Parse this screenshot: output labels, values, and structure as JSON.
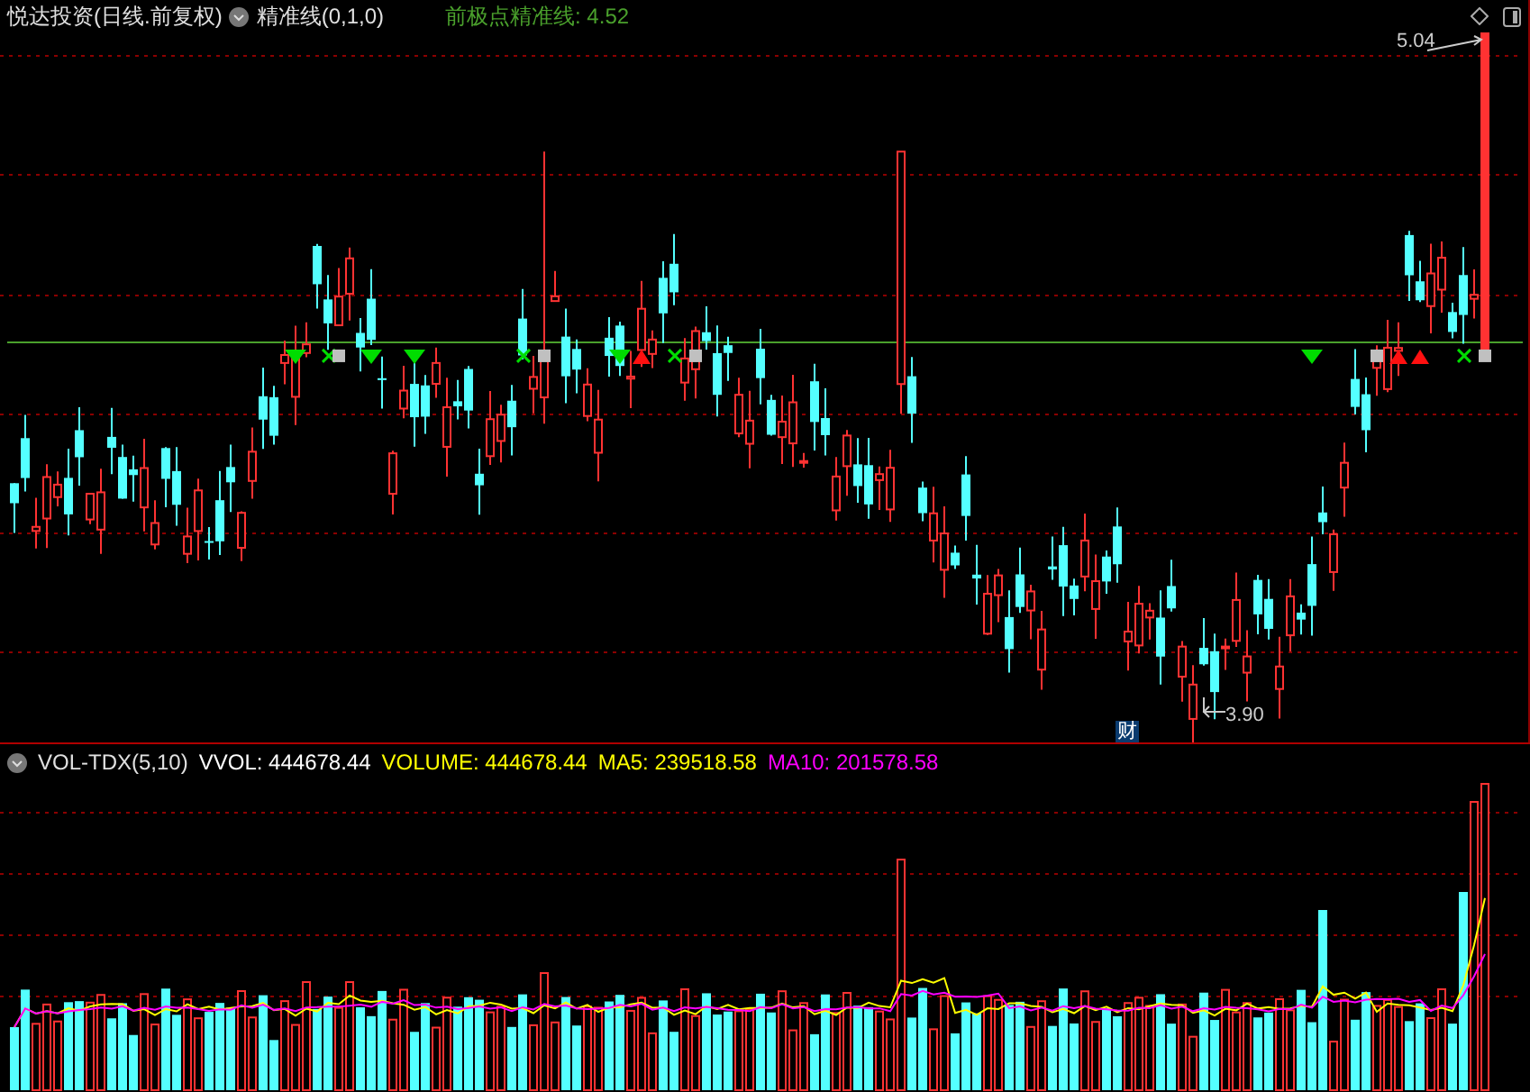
{
  "header": {
    "title": "悦达投资(日线.前复权)",
    "indicator": "精准线(0,1,0)",
    "line_label": "前极点精准线: 4.52"
  },
  "price_labels": {
    "high": "5.04",
    "low": "3.90"
  },
  "finance_badge": "财",
  "volume_header": {
    "name": "VOL-TDX(5,10)",
    "items": [
      {
        "label": "VVOL: 444678.44",
        "color": "#ffffff"
      },
      {
        "label": "VOLUME: 444678.44",
        "color": "#ffff00"
      },
      {
        "label": "MA5: 239518.58",
        "color": "#ffff00"
      },
      {
        "label": "MA10: 201578.58",
        "color": "#ff00ff"
      }
    ]
  }
}
